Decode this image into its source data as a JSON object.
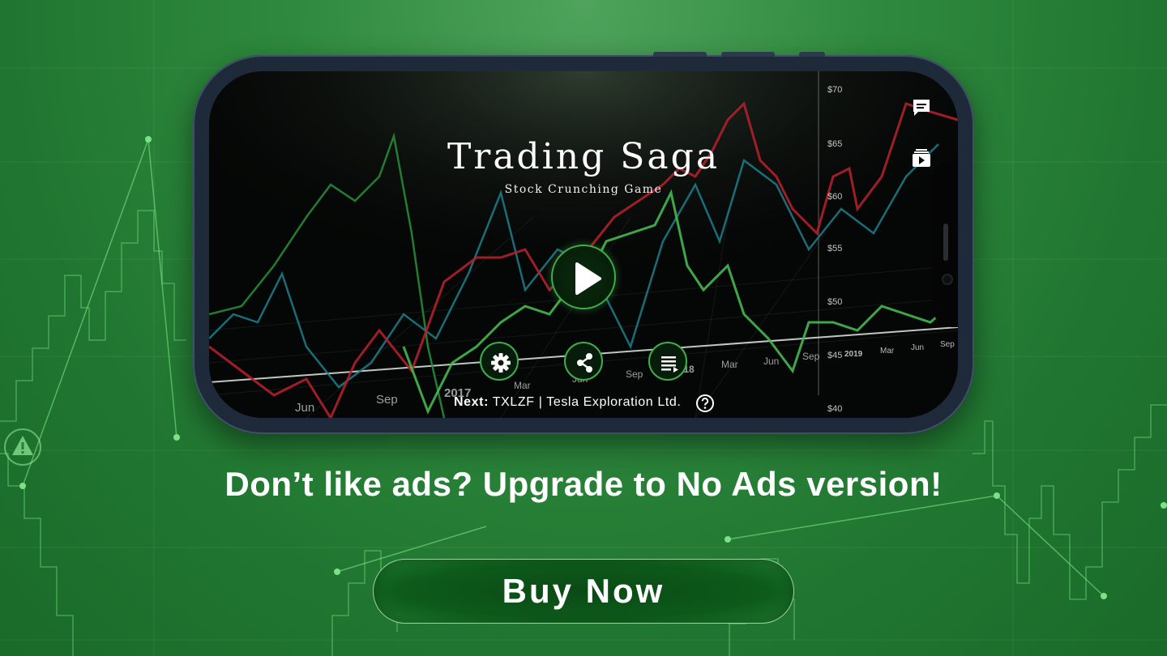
{
  "game": {
    "title": "Trading Saga",
    "subtitle": "Stock Crunching Game"
  },
  "next": {
    "label": "Next:",
    "ticker": "TXLZF | Tesla Exploration Ltd."
  },
  "axis": {
    "price_labels": [
      "$70",
      "$65",
      "$60",
      "$55",
      "$50",
      "$45",
      "$40"
    ],
    "time_labels_right": [
      "2019",
      "Mar",
      "Jun",
      "Sep"
    ],
    "time_labels_mid": [
      "Mar",
      "Jun",
      "Sep",
      "2018",
      "Mar",
      "Jun",
      "Sep"
    ],
    "time_labels_front": [
      "Jun",
      "Sep",
      "2017"
    ]
  },
  "icons": {
    "play": "play-icon",
    "settings": "gear-icon",
    "share": "share-icon",
    "playlist": "playlist-icon",
    "chat": "chat-icon",
    "video": "video-icon",
    "help": "help-icon",
    "warning": "warning-icon"
  },
  "promo": {
    "headline": "Don’t like ads? Upgrade to No Ads version!",
    "button_label": "Buy Now"
  },
  "colors": {
    "background": "#2f8a3e",
    "accent_green": "#3fae4a",
    "chart_red": "#b0202a",
    "chart_teal": "#2a8fa0",
    "chart_green": "#46b850",
    "button_bg": "#0a4a15"
  }
}
